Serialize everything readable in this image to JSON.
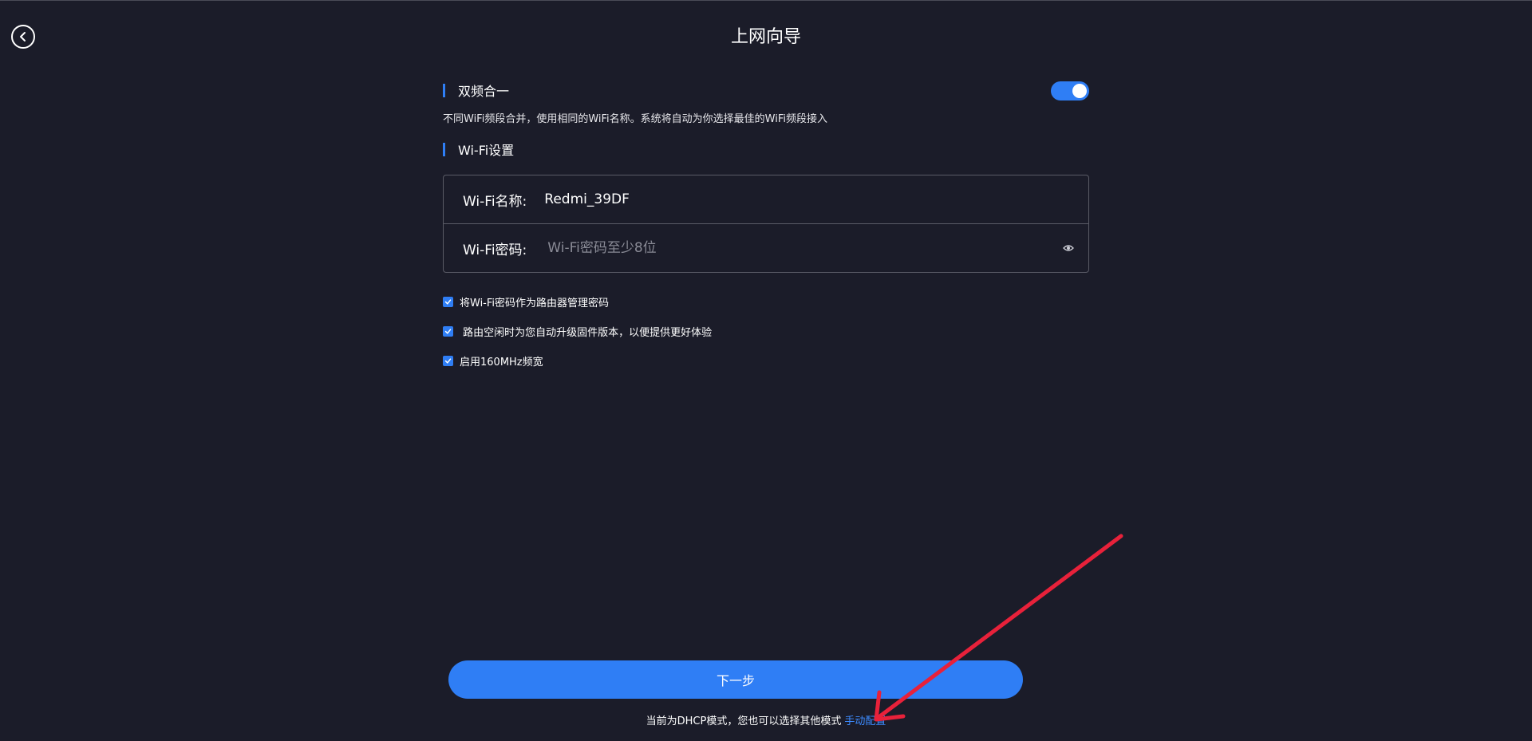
{
  "header": {
    "title": "上网向导",
    "back_icon": "back-arrow-icon"
  },
  "dual_band": {
    "title": "双频合一",
    "enabled": true,
    "description": "不同WiFi频段合并，使用相同的WiFi名称。系统将自动为你选择最佳的WiFi频段接入"
  },
  "wifi_settings": {
    "title": "Wi-Fi设置",
    "name_label": "Wi-Fi名称:",
    "name_value": "Redmi_39DF",
    "password_label": "Wi-Fi密码:",
    "password_placeholder": "Wi-Fi密码至少8位",
    "eye_icon": "eye-icon"
  },
  "options": [
    {
      "label": "将Wi-Fi密码作为路由器管理密码",
      "checked": true
    },
    {
      "label": " 路由空闲时为您自动升级固件版本，以便提供更好体验",
      "checked": true
    },
    {
      "label": "启用160MHz频宽",
      "checked": true
    }
  ],
  "actions": {
    "next_label": "下一步"
  },
  "footer": {
    "note": "当前为DHCP模式，您也可以选择其他模式",
    "manual_link": "手动配置"
  },
  "colors": {
    "background": "#1b1c29",
    "accent": "#2f7ef5",
    "link": "#3d8bff",
    "annotation": "#e8213a"
  }
}
